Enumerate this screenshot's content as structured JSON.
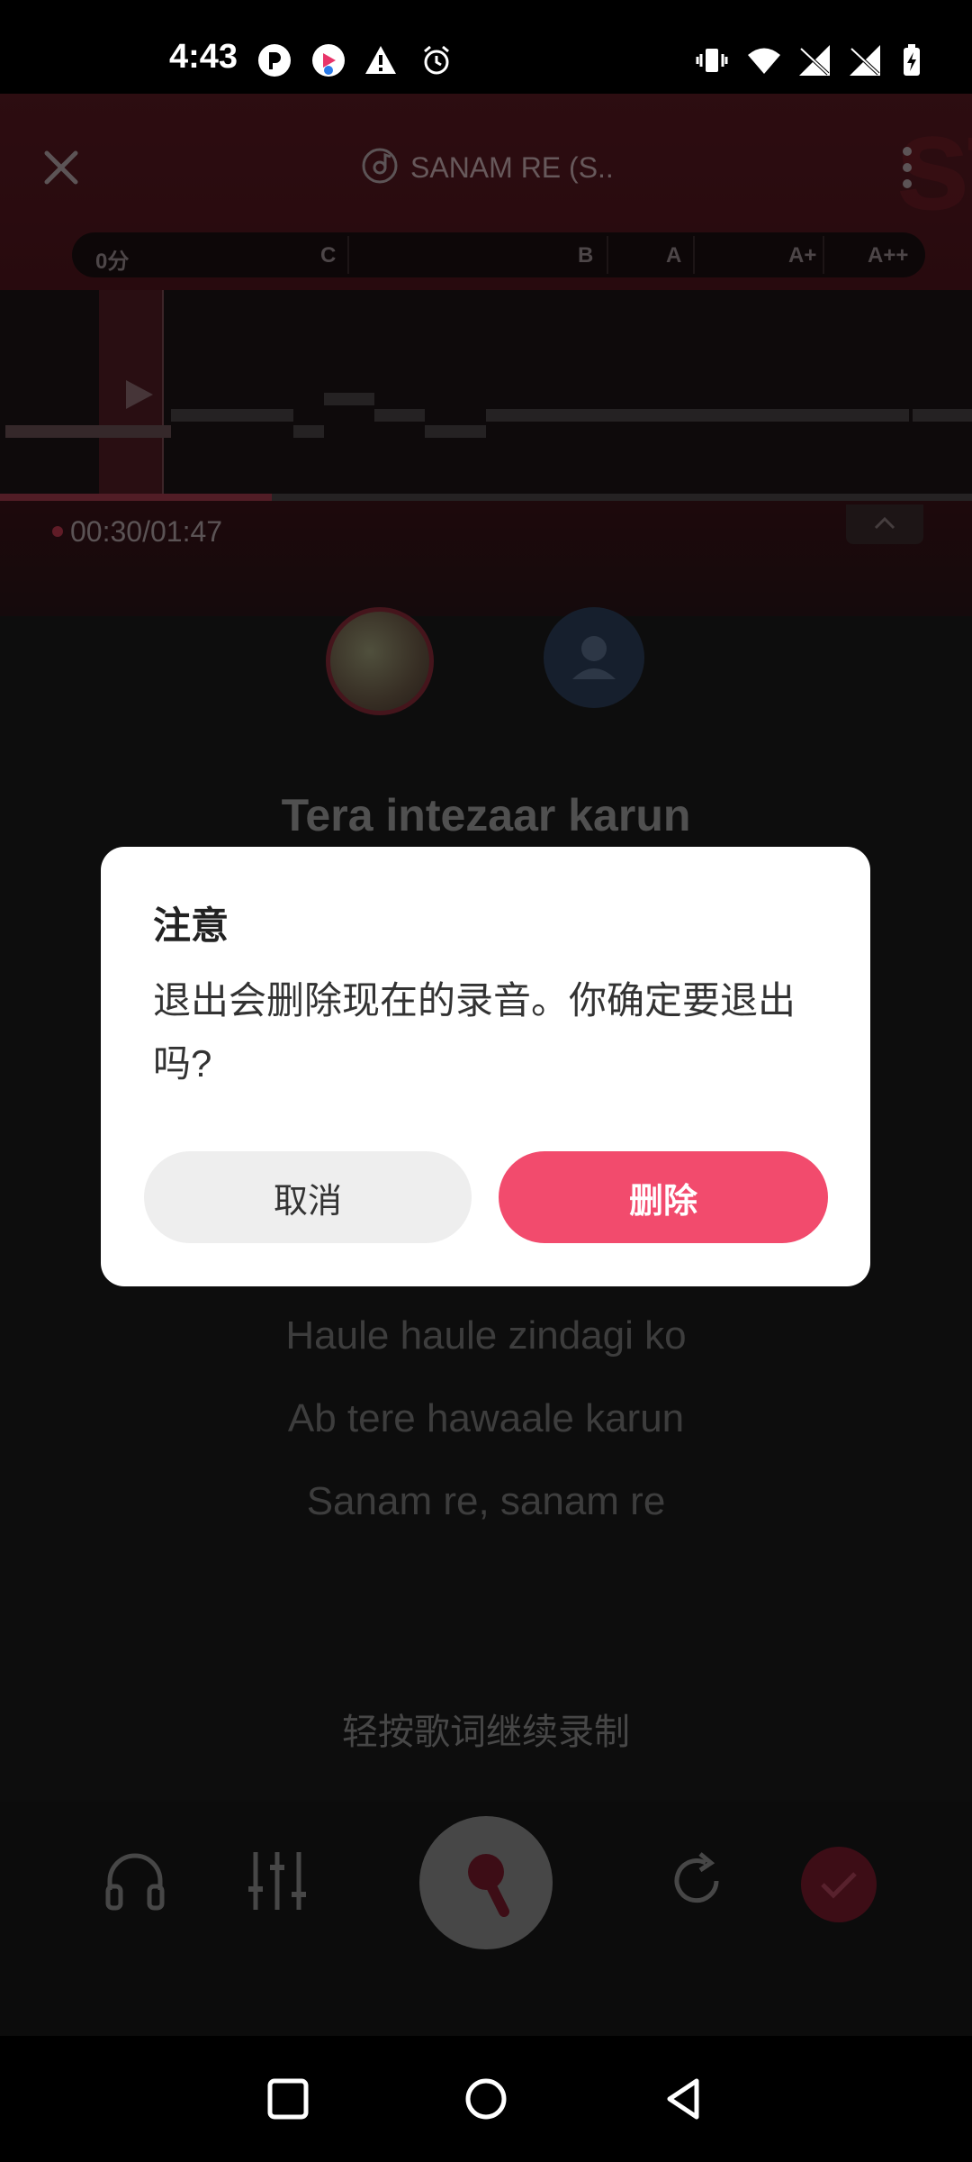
{
  "status_bar": {
    "time": "4:43",
    "left_icons": [
      "notification-app-icon",
      "app-logo-icon",
      "warning-icon",
      "alarm-icon"
    ],
    "right_icons": [
      "vibrate-icon",
      "wifi-icon",
      "signal-icon",
      "signal-icon-2",
      "battery-charging-icon"
    ]
  },
  "header": {
    "song_title": "SANAM RE (S..",
    "bg_watermark": "st"
  },
  "score_bar": {
    "labels": [
      "0分",
      "C",
      "B",
      "A",
      "A+",
      "A++"
    ]
  },
  "recording": {
    "time": "00:30/01:47",
    "progress": 0.28
  },
  "lyrics": {
    "active": "Tera intezaar karun",
    "upcoming": [
      "Haule haule zindagi ko",
      "Ab tere hawaale karun",
      "Sanam re, sanam re"
    ]
  },
  "hint_text": "轻按歌词继续录制",
  "dialog": {
    "title": "注意",
    "message": "退出会删除现在的录音。你确定要退出吗?",
    "cancel_label": "取消",
    "delete_label": "删除"
  },
  "colors": {
    "accent": "#f24b6d",
    "hero_bg": "#5a1a22",
    "done_button": "#7a1b2c"
  }
}
